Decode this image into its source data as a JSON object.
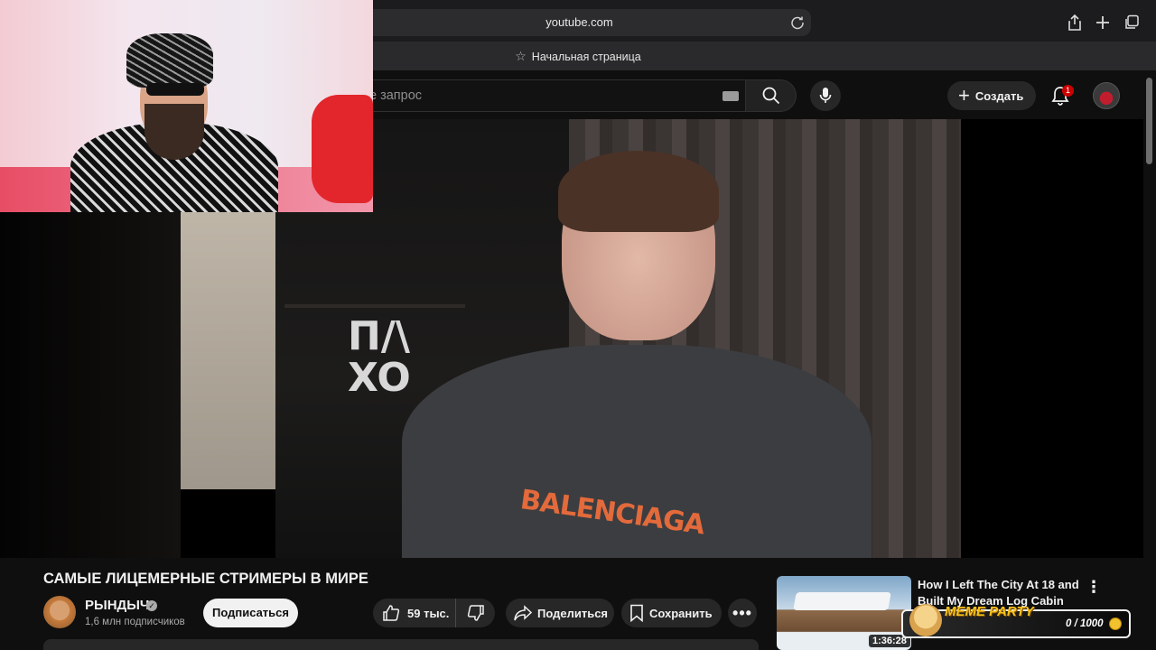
{
  "browser": {
    "url": "youtube.com",
    "tab_title": "Начальная страница"
  },
  "header": {
    "search_placeholder": "е запрос",
    "create_label": "Создать",
    "notification_count": "1"
  },
  "video": {
    "title": "САМЫЕ ЛИЦЕМЕРНЫЕ СТРИМЕРЫ В МИРЕ",
    "channel_name": "РЫНДЫЧ",
    "subscribers": "1,6 млн подписчиков",
    "subscribe_label": "Подписаться",
    "likes": "59 тыс.",
    "share_label": "Поделиться",
    "save_label": "Сохранить"
  },
  "recommendation": {
    "title": "How I Left The City At 18 and Built My Dream Log Cabin",
    "duration": "1:36:28"
  },
  "overlay": {
    "meme_label": "MEME PARTY",
    "meme_count": "0 / 1000"
  },
  "colors": {
    "background": "#0f0f0f",
    "pill": "#272727",
    "badge": "#cc0000",
    "meme_accent": "#f6c21c"
  }
}
